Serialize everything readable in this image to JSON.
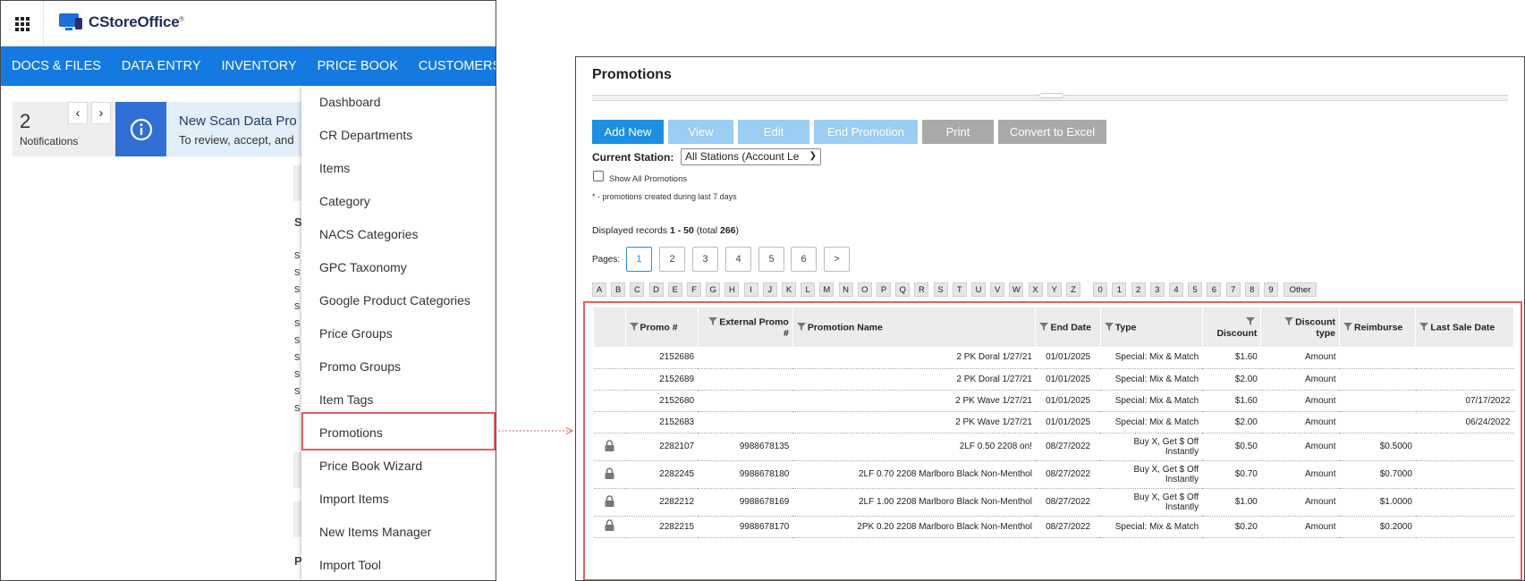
{
  "left": {
    "brand": "CStoreOffice",
    "brand_mark": "®",
    "nav": [
      "DOCS & FILES",
      "DATA ENTRY",
      "INVENTORY",
      "PRICE BOOK",
      "CUSTOMERS"
    ],
    "notifications": {
      "count": "2",
      "label": "Notifications"
    },
    "banner": {
      "title": "New Scan Data Pro",
      "subtitle": "To review, accept, and"
    },
    "peek": {
      "section_letter": "S",
      "row_letter": "s",
      "bottom_letter": "P"
    },
    "menu": [
      "Dashboard",
      "CR Departments",
      "Items",
      "Category",
      "NACS Categories",
      "GPC Taxonomy",
      "Google Product Categories",
      "Price Groups",
      "Promo Groups",
      "Item Tags",
      "Promotions",
      "Price Book Wizard",
      "Import Items",
      "New Items Manager",
      "Import Tool"
    ]
  },
  "right": {
    "title": "Promotions",
    "toolbar": {
      "add": "Add New",
      "view": "View",
      "edit": "Edit",
      "end": "End Promotion",
      "print": "Print",
      "excel": "Convert to Excel"
    },
    "station_label": "Current Station:",
    "station_value": "All Stations (Account Le",
    "show_all": "Show All Promotions",
    "note": "* - promotions created during last 7 days",
    "records": {
      "prefix": "Displayed records ",
      "range": "1 - 50",
      "mid": " (total ",
      "total": "266",
      "suffix": ")"
    },
    "pages_label": "Pages:",
    "pages": [
      "1",
      "2",
      "3",
      "4",
      "5",
      "6",
      ">"
    ],
    "letters": [
      "A",
      "B",
      "C",
      "D",
      "E",
      "F",
      "G",
      "H",
      "I",
      "J",
      "K",
      "L",
      "M",
      "N",
      "O",
      "P",
      "Q",
      "R",
      "S",
      "T",
      "U",
      "V",
      "W",
      "X",
      "Y",
      "Z",
      "0",
      "1",
      "2",
      "3",
      "4",
      "5",
      "6",
      "7",
      "8",
      "9",
      "Other"
    ],
    "columns": {
      "promo": "Promo #",
      "external": "External Promo #",
      "name": "Promotion Name",
      "end_date": "End Date",
      "type": "Type",
      "discount": "Discount",
      "discount_type": "Discount type",
      "reimburse": "Reimburse",
      "last_sale": "Last Sale Date"
    },
    "rows": [
      {
        "locked": false,
        "promo": "2152686",
        "external": "",
        "name": "2 PK Doral 1/27/21",
        "end": "01/01/2025",
        "type1": "Special: Mix & Match",
        "type2": "",
        "discount": "$1.60",
        "dtype": "Amount",
        "reimburse": "",
        "last_sale": ""
      },
      {
        "locked": false,
        "promo": "2152689",
        "external": "",
        "name": "2 PK Doral 1/27/21",
        "end": "01/01/2025",
        "type1": "Special: Mix & Match",
        "type2": "",
        "discount": "$2.00",
        "dtype": "Amount",
        "reimburse": "",
        "last_sale": ""
      },
      {
        "locked": false,
        "promo": "2152680",
        "external": "",
        "name": "2 PK Wave 1/27/21",
        "end": "01/01/2025",
        "type1": "Special: Mix & Match",
        "type2": "",
        "discount": "$1.60",
        "dtype": "Amount",
        "reimburse": "",
        "last_sale": "07/17/2022"
      },
      {
        "locked": false,
        "promo": "2152683",
        "external": "",
        "name": "2 PK Wave 1/27/21",
        "end": "01/01/2025",
        "type1": "Special: Mix & Match",
        "type2": "",
        "discount": "$2.00",
        "dtype": "Amount",
        "reimburse": "",
        "last_sale": "06/24/2022"
      },
      {
        "locked": true,
        "promo": "2282107",
        "external": "9988678135",
        "name": "2LF 0.50 2208 on!",
        "end": "08/27/2022",
        "type1": "Buy X, Get $ Off",
        "type2": "Instantly",
        "discount": "$0.50",
        "dtype": "Amount",
        "reimburse": "$0.5000",
        "last_sale": ""
      },
      {
        "locked": true,
        "promo": "2282245",
        "external": "9988678180",
        "name": "2LF 0.70 2208 Marlboro Black Non-Menthol",
        "end": "08/27/2022",
        "type1": "Buy X, Get $ Off",
        "type2": "Instantly",
        "discount": "$0.70",
        "dtype": "Amount",
        "reimburse": "$0.7000",
        "last_sale": ""
      },
      {
        "locked": true,
        "promo": "2282212",
        "external": "9988678169",
        "name": "2LF 1.00 2208 Marlboro Black Non-Menthol",
        "end": "08/27/2022",
        "type1": "Buy X, Get $ Off",
        "type2": "Instantly",
        "discount": "$1.00",
        "dtype": "Amount",
        "reimburse": "$1.0000",
        "last_sale": ""
      },
      {
        "locked": true,
        "promo": "2282215",
        "external": "9988678170",
        "name": "2PK 0.20 2208 Marlboro Black Non-Menthol",
        "end": "08/27/2022",
        "type1": "Special: Mix & Match",
        "type2": "",
        "discount": "$0.20",
        "dtype": "Amount",
        "reimburse": "$0.2000",
        "last_sale": ""
      }
    ]
  },
  "colors": {
    "nav_blue": "#1479e0",
    "highlight_red": "#e06060",
    "add_button": "#1c8fe0",
    "disabled_button": "#9ccdf3",
    "gray_button": "#a9a9a9"
  }
}
